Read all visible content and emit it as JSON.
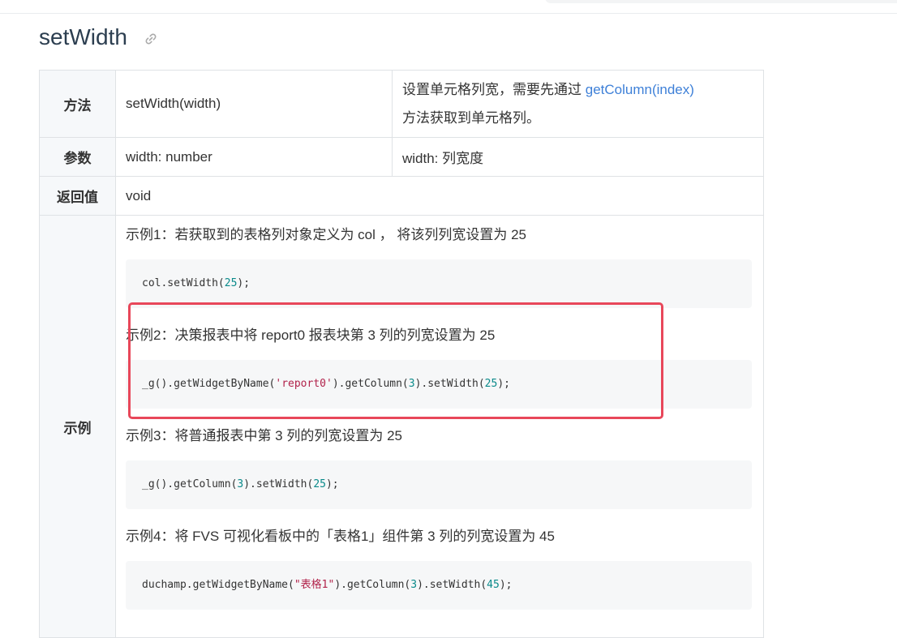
{
  "page": {
    "title": "setWidth"
  },
  "table": {
    "method_label": "方法",
    "method_signature": "setWidth(width)",
    "method_desc_pre": "设置单元格列宽，需要先通过",
    "method_desc_link": "getColumn(index)",
    "method_desc_post": "方法获取到单元格列。",
    "params_label": "参数",
    "params_type": "width: number",
    "params_desc": "width:  列宽度",
    "return_label": "返回值",
    "return_value": "void",
    "example_label": "示例"
  },
  "examples": [
    {
      "label": "示例1：若获取到的表格列对象定义为 col ， 将该列列宽设置为 25",
      "code_a": "col.setWidth(",
      "code_num": "25",
      "code_b": ");"
    },
    {
      "label": "示例2：决策报表中将 report0 报表块第 3 列的列宽设置为 25",
      "code_a": "_g().getWidgetByName(",
      "code_str": "'report0'",
      "code_b": ").getColumn(",
      "code_num1": "3",
      "code_c": ").setWidth(",
      "code_num2": "25",
      "code_d": ");"
    },
    {
      "label": "示例3：将普通报表中第 3 列的列宽设置为 25",
      "code_a": "_g().getColumn(",
      "code_num1": "3",
      "code_b": ").setWidth(",
      "code_num2": "25",
      "code_c": ");"
    },
    {
      "label": "示例4：将 FVS 可视化看板中的「表格1」组件第 3 列的列宽设置为 45",
      "code_a": "duchamp.getWidgetByName(",
      "code_str": "\"表格1\"",
      "code_b": ").getColumn(",
      "code_num1": "3",
      "code_c": ").setWidth(",
      "code_num2": "45",
      "code_d": ");"
    }
  ],
  "colors": {
    "link": "#3e80d8",
    "highlight_border": "#e8475a",
    "code_number": "#0a8a8a",
    "code_string": "#b1224a"
  },
  "icons": {
    "heading_anchor": "link-icon"
  }
}
